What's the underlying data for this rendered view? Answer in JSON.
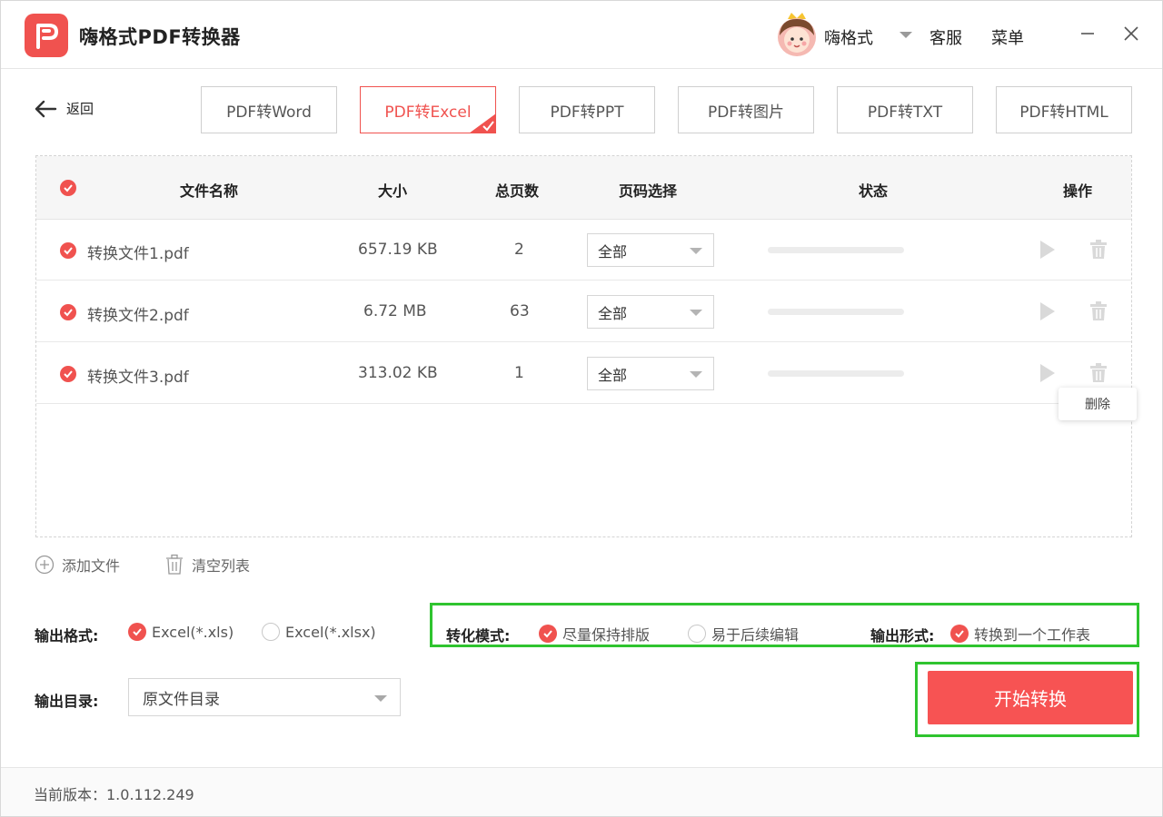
{
  "app": {
    "title": "嗨格式PDF转换器"
  },
  "header": {
    "user_name": "嗨格式",
    "service_label": "客服",
    "menu_label": "菜单"
  },
  "nav": {
    "back_label": "返回"
  },
  "tabs": [
    {
      "label": "PDF转Word",
      "active": false
    },
    {
      "label": "PDF转Excel",
      "active": true
    },
    {
      "label": "PDF转PPT",
      "active": false
    },
    {
      "label": "PDF转图片",
      "active": false
    },
    {
      "label": "PDF转TXT",
      "active": false
    },
    {
      "label": "PDF转HTML",
      "active": false
    }
  ],
  "table": {
    "headers": {
      "name": "文件名称",
      "size": "大小",
      "pages": "总页数",
      "page_select": "页码选择",
      "status": "状态",
      "actions": "操作"
    },
    "rows": [
      {
        "name": "转换文件1.pdf",
        "size": "657.19 KB",
        "pages": "2",
        "page_select": "全部",
        "progress": 0
      },
      {
        "name": "转换文件2.pdf",
        "size": "6.72 MB",
        "pages": "63",
        "page_select": "全部",
        "progress": 0
      },
      {
        "name": "转换文件3.pdf",
        "size": "313.02 KB",
        "pages": "1",
        "page_select": "全部",
        "progress": 0
      }
    ],
    "delete_tooltip": "删除"
  },
  "list_actions": {
    "add_files": "添加文件",
    "clear_list": "清空列表"
  },
  "options": {
    "format_label": "输出格式:",
    "format_xls": "Excel(*.xls)",
    "format_xlsx": "Excel(*.xlsx)",
    "format_selected": "xls",
    "mode_label": "转化模式:",
    "mode_keep_layout": "尽量保持排版",
    "mode_easy_edit": "易于后续编辑",
    "mode_selected": "keep_layout",
    "output_form_label": "输出形式:",
    "output_form_one_sheet": "转换到一个工作表",
    "output_form_checked": true,
    "dir_label": "输出目录:",
    "dir_value": "原文件目录"
  },
  "start_button": "开始转换",
  "footer": {
    "version": "当前版本：1.0.112.249"
  },
  "colors": {
    "accent": "#f0524f",
    "highlight_box": "#2fc42f"
  }
}
